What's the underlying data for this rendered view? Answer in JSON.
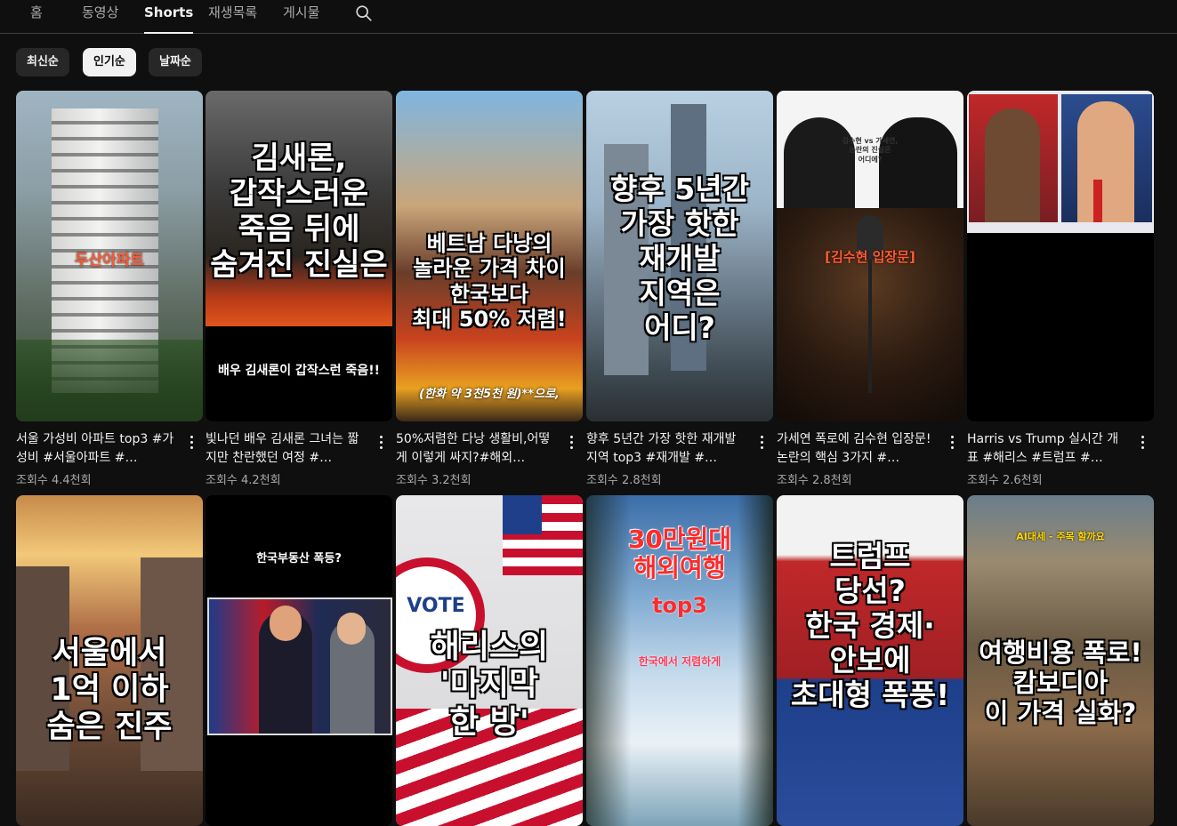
{
  "tabs": [
    {
      "label": "홈"
    },
    {
      "label": "동영상"
    },
    {
      "label": "Shorts",
      "active": true
    },
    {
      "label": "재생목록"
    },
    {
      "label": "게시물"
    }
  ],
  "search_icon": "search-icon",
  "chips": [
    {
      "label": "최신순"
    },
    {
      "label": "인기순",
      "selected": true
    },
    {
      "label": "날짜순"
    }
  ],
  "videos": [
    {
      "title": "서울 가성비 아파트 top3 #가성비 #서울아파트 #…",
      "views": "조회수 4.4천회",
      "overlay": "두산아파트",
      "overlay_color": "#ff4a2a"
    },
    {
      "title": "빛나던 배우 김새론 그녀는 짧지만 찬란했던 여정 #…",
      "views": "조회수 4.2천회",
      "overlay": "김새론,\n갑작스러운\n죽음 뒤에\n숨겨진 진실은",
      "caption": "배우 김새론이 갑작스런 죽음!!"
    },
    {
      "title": "50%저렴한 다낭 생활비,어떻게 이렇게 싸지?#해외…",
      "views": "조회수 3.2천회",
      "overlay": "베트남 다낭의\n놀라운 가격 차이\n한국보다\n최대 50% 저렴!",
      "caption": "(한화 약 3천5천 원)**으로,"
    },
    {
      "title": "향후 5년간 가장 핫한 재개발지역 top3 #재개발 #…",
      "views": "조회수 2.8천회",
      "overlay": "향후 5년간\n가장 핫한\n재개발\n지역은\n어디?"
    },
    {
      "title": "가세연 폭로에 김수현 입장문! 논란의 핵심 3가지 #…",
      "views": "조회수 2.8천회",
      "overlay": "[김수현 입장문]",
      "overlay_color": "#ff4a2a",
      "small_text": "김수현 vs 가세연,\n논란의 진실은\n어디에?"
    },
    {
      "title": "Harris vs Trump 실시간 개표 #해리스 #트럼프 #…",
      "views": "조회수 2.6천회"
    },
    {
      "overlay": "서울에서\n1억 이하\n숨은 진주"
    },
    {
      "overlay": "한국부동산 폭등?"
    },
    {
      "overlay": "해리스의\n'마지막\n한 방'",
      "badge": "VOTE"
    },
    {
      "overlay": "30만원대\n해외여행",
      "overlay_sub": "top3",
      "caption": "한국에서 저렴하게"
    },
    {
      "overlay": "트럼프\n당선?\n한국 경제·\n안보에\n초대형 폭풍!"
    },
    {
      "overlay": "여행비용 폭로!\n캄보디아\n이 가격 실화?",
      "small_text": "AI대세 - 주목 할까요"
    }
  ]
}
